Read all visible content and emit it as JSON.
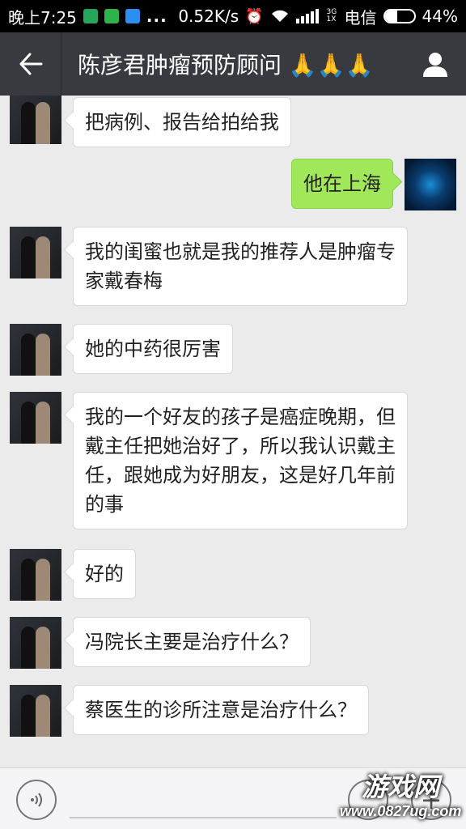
{
  "status_bar": {
    "time": "晚上7:25",
    "dots": "...",
    "speed": "0.52K/s",
    "network": "3G 1X",
    "carrier": "电信",
    "battery_text": "44%",
    "battery_level": 0.44
  },
  "header": {
    "title": "陈彦君肿瘤预防顾问 🙏🙏🙏"
  },
  "messages": [
    {
      "side": "left",
      "text": "把病例、报告给拍给我"
    },
    {
      "side": "right",
      "text": "他在上海"
    },
    {
      "side": "left",
      "text": "我的闺蜜也就是我的推荐人是肿瘤专家戴春梅"
    },
    {
      "side": "left",
      "text": "她的中药很厉害"
    },
    {
      "side": "left",
      "text": "我的一个好友的孩子是癌症晚期，但戴主任把她治好了，所以我认识戴主任，跟她成为好朋友，这是好几年前的事"
    },
    {
      "side": "left",
      "text": "好的"
    },
    {
      "side": "left",
      "text": "冯院长主要是治疗什么？"
    },
    {
      "side": "left",
      "text": "蔡医生的诊所注意是治疗什么？"
    }
  ],
  "input_bar": {
    "plus_label": "+"
  },
  "watermark": {
    "main": "游戏网",
    "sub": "www.0827ug.com"
  }
}
